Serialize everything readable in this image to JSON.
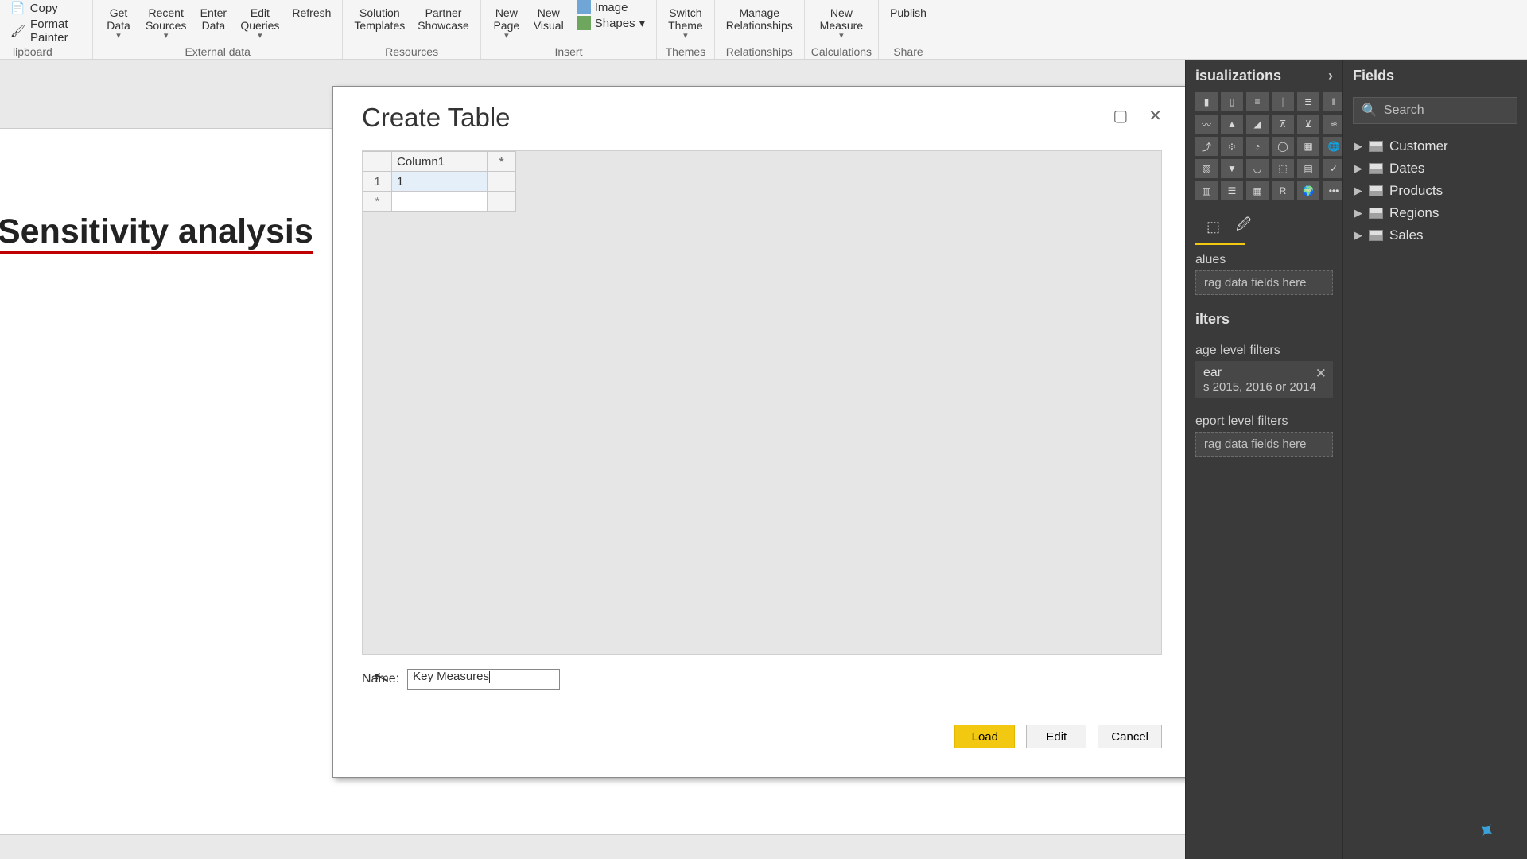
{
  "ribbon": {
    "clipboard": {
      "copy": "Copy",
      "format_painter": "Format Painter",
      "group_label": "lipboard"
    },
    "external": {
      "get_data": "Get\nData",
      "recent": "Recent\nSources",
      "enter": "Enter\nData",
      "edit": "Edit\nQueries",
      "refresh": "Refresh",
      "group_label": "External data"
    },
    "resources": {
      "templates": "Solution\nTemplates",
      "partner": "Partner\nShowcase",
      "group_label": "Resources"
    },
    "insert": {
      "new_page": "New\nPage",
      "new_visual": "New\nVisual",
      "image": "Image",
      "shapes": "Shapes",
      "group_label": "Insert"
    },
    "themes": {
      "switch": "Switch\nTheme",
      "group_label": "Themes"
    },
    "relationships": {
      "manage": "Manage\nRelationships",
      "group_label": "Relationships"
    },
    "calculations": {
      "new_measure": "New\nMeasure",
      "group_label": "Calculations"
    },
    "share": {
      "publish": "Publish",
      "group_label": "Share"
    },
    "dropdown_caret": "▾"
  },
  "page": {
    "heading": "Sensitivity analysis"
  },
  "dialog": {
    "title": "Create Table",
    "column1": "Column1",
    "addcol": "*",
    "row1_index": "1",
    "row1_value": "1",
    "row_asterisk": "*",
    "name_label": "Name:",
    "name_value": "Key Measures",
    "buttons": {
      "load": "Load",
      "edit": "Edit",
      "cancel": "Cancel"
    },
    "window": {
      "max": "▢",
      "close": "✕"
    }
  },
  "viz": {
    "title": "isualizations",
    "values_label": "alues",
    "values_drop": "rag data fields here",
    "filters_label": "ilters",
    "page_filters": "age level filters",
    "filter_year_name": "ear",
    "filter_year_desc": "s 2015, 2016 or 2014",
    "report_filters": "eport level filters",
    "report_drop": "rag data fields here",
    "format_icon1": "⬚",
    "format_icon2": "🖉",
    "more": "•••"
  },
  "fields": {
    "title": "Fields",
    "search_placeholder": "Search",
    "items": [
      "Customer",
      "Dates",
      "Products",
      "Regions",
      "Sales"
    ]
  },
  "icons": {
    "search": "🔍"
  }
}
